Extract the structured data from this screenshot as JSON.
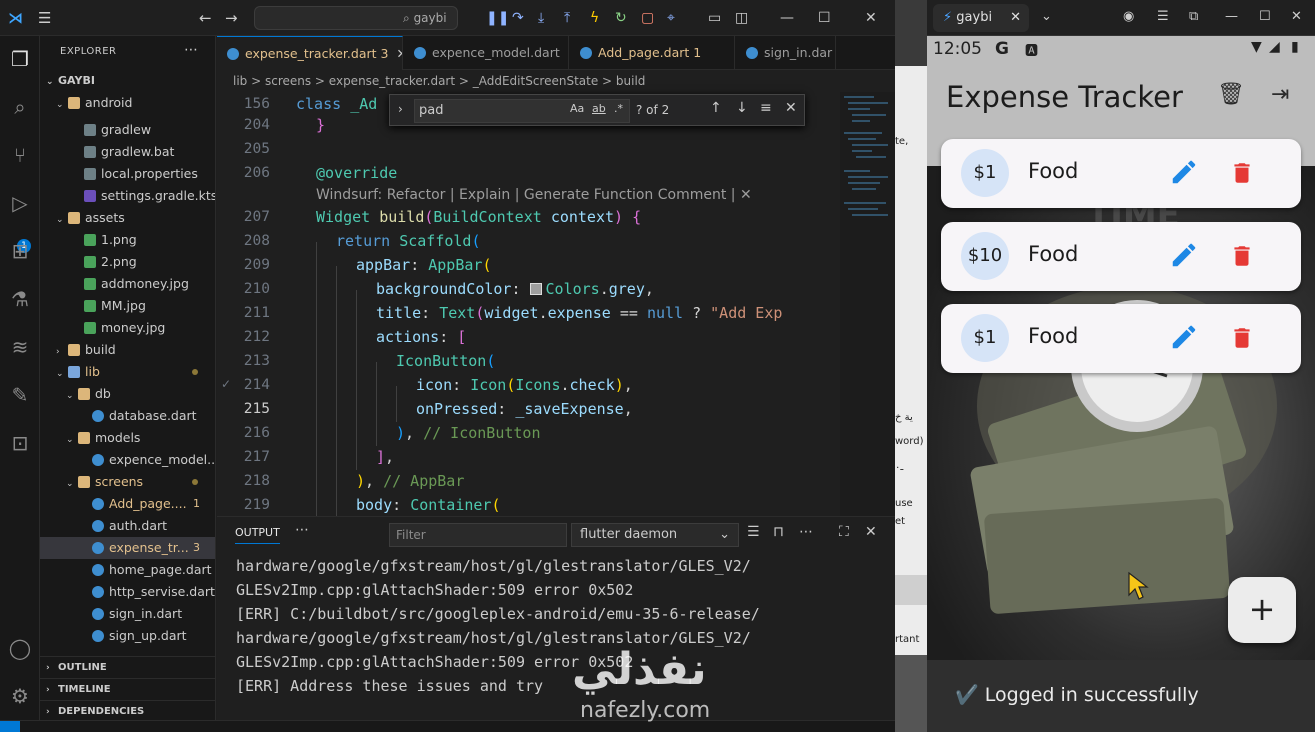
{
  "vscode": {
    "search_text": "gaybi",
    "explorer_title": "EXPLORER",
    "project": "GAYBI",
    "tree": [
      {
        "label": "android",
        "type": "folder",
        "open": true
      },
      {
        "label": "gradlew",
        "type": "file"
      },
      {
        "label": "gradlew.bat",
        "type": "file"
      },
      {
        "label": "local.properties",
        "type": "file"
      },
      {
        "label": "settings.gradle.kts",
        "type": "gradle"
      },
      {
        "label": "assets",
        "type": "folder",
        "open": true
      },
      {
        "label": "1.png",
        "type": "img"
      },
      {
        "label": "2.png",
        "type": "img"
      },
      {
        "label": "addmoney.jpg",
        "type": "img"
      },
      {
        "label": "MM.jpg",
        "type": "img"
      },
      {
        "label": "money.jpg",
        "type": "img"
      },
      {
        "label": "build",
        "type": "folder",
        "open": false
      },
      {
        "label": "lib",
        "type": "folder",
        "open": true
      },
      {
        "label": "db",
        "type": "folder",
        "open": true
      },
      {
        "label": "database.dart",
        "type": "dart"
      },
      {
        "label": "models",
        "type": "folder",
        "open": true
      },
      {
        "label": "expence_model...",
        "type": "dart"
      },
      {
        "label": "screens",
        "type": "folder",
        "open": true
      },
      {
        "label": "Add_page....",
        "type": "dart",
        "badge": "1"
      },
      {
        "label": "auth.dart",
        "type": "dart"
      },
      {
        "label": "expense_tr...",
        "type": "dart",
        "badge": "3"
      },
      {
        "label": "home_page.dart",
        "type": "dart"
      },
      {
        "label": "http_servise.dart",
        "type": "dart"
      },
      {
        "label": "sign_in.dart",
        "type": "dart"
      },
      {
        "label": "sign_up.dart",
        "type": "dart"
      }
    ],
    "sections": [
      "OUTLINE",
      "TIMELINE",
      "DEPENDENCIES"
    ],
    "tabs": [
      {
        "label": "expense_tracker.dart",
        "badge": "3",
        "active": true
      },
      {
        "label": "expence_model.dart",
        "badge": "",
        "active": false
      },
      {
        "label": "Add_page.dart",
        "badge": "1",
        "active": false
      },
      {
        "label": "sign_in.dar",
        "badge": "",
        "active": false
      }
    ],
    "breadcrumb": "lib > screens > expense_tracker.dart > _AddEditScreenState > build",
    "find": {
      "query": "pad",
      "count": "? of 2"
    },
    "code_lens": "Windsurf: Refactor | Explain | Generate Function Comment | ✕",
    "line_numbers": [
      "156",
      "204",
      "205",
      "206",
      "207",
      "208",
      "209",
      "210",
      "211",
      "212",
      "213",
      "214",
      "215",
      "216",
      "217",
      "218",
      "219"
    ],
    "output": {
      "title": "OUTPUT",
      "filter_placeholder": "Filter",
      "channel": "flutter daemon",
      "lines": [
        "hardware/google/gfxstream/host/gl/glestranslator/GLES_V2/",
        "GLESv2Imp.cpp:glAttachShader:509 error 0x502",
        "[ERR] C:/buildbot/src/googleplex-android/emu-35-6-release/",
        "hardware/google/gfxstream/host/gl/glestranslator/GLES_V2/",
        "GLESv2Imp.cpp:glAttachShader:509 error 0x502",
        "[ERR] Address these issues and try"
      ]
    },
    "accent": "#0078d4"
  },
  "background_window_text": [
    "te,",
    "ية خ",
    "word)",
    "ـ٠",
    "use",
    "et",
    "rtant"
  ],
  "emulator": {
    "tab_label": "gaybi",
    "time": "12:05",
    "status_g": "G",
    "app_title": "Expense Tracker",
    "expenses": [
      {
        "amount": "$1",
        "category": "Food"
      },
      {
        "amount": "$10",
        "category": "Food"
      },
      {
        "amount": "$1",
        "category": "Food"
      }
    ],
    "fab_label": "+",
    "snackbar": "✔️ Logged in successfully",
    "edit_color": "#1e88e5",
    "delete_color": "#e53935"
  },
  "watermark": {
    "arabic": "نفذلي",
    "url": "nafezly.com"
  }
}
